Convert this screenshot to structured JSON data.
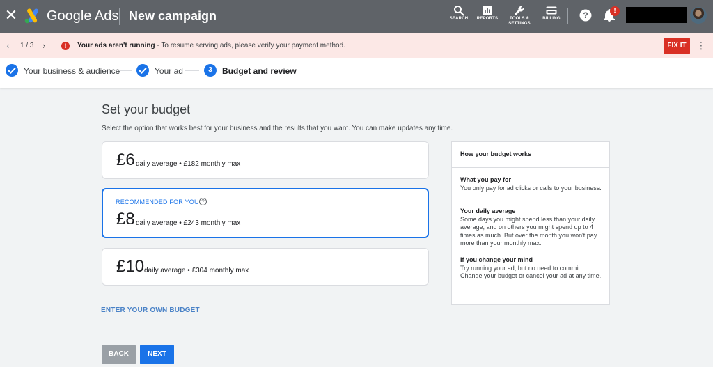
{
  "header": {
    "close_icon": "close-icon",
    "product_name": "Google Ads",
    "campaign_title": "New campaign",
    "tools": [
      {
        "label": "SEARCH",
        "icon": "search-icon"
      },
      {
        "label": "REPORTS",
        "icon": "reports-icon"
      },
      {
        "label": "TOOLS & SETTINGS",
        "icon": "wrench-icon"
      },
      {
        "label": "BILLING",
        "icon": "billing-card-icon"
      }
    ],
    "notification_count": "!",
    "colors": {
      "bar": "#5f6368",
      "accent": "#1a73e8"
    }
  },
  "alert": {
    "page_indicator": "1 / 3",
    "alert_icon_glyph": "!",
    "title": "Your ads aren't running",
    "message": " - To resume serving ads, please verify your payment method.",
    "fix_label": "FIX IT",
    "colors": {
      "background": "#fce8e6",
      "error": "#d93025"
    }
  },
  "stepper": {
    "steps": [
      {
        "label": "Your business & audience",
        "state": "done"
      },
      {
        "label": "Your ad",
        "state": "done"
      },
      {
        "label": "Budget and review",
        "state": "current",
        "number": "3"
      }
    ]
  },
  "main": {
    "title": "Set your budget",
    "subtitle": "Select the option that works best for your business and the results that you want. You can make updates any time.",
    "options": [
      {
        "amount": "£6",
        "description": "daily average • £182 monthly max",
        "selected": false
      },
      {
        "badge": "RECOMMENDED FOR YOU",
        "help_glyph": "?",
        "amount": "£8",
        "description": "daily average • £243 monthly max",
        "selected": true
      },
      {
        "amount": "£10",
        "description": "daily average • £304 monthly max",
        "selected": false
      }
    ],
    "own_budget_link": "ENTER YOUR OWN BUDGET",
    "back_label": "BACK",
    "next_label": "NEXT"
  },
  "info_panel": {
    "title": "How your budget works",
    "sections": [
      {
        "heading": "What you pay for",
        "body": "You only pay for ad clicks or calls to your business."
      },
      {
        "heading": "Your daily average",
        "body": "Some days you might spend less than your daily average, and on others you might spend up to 4 times as much. But over the month you won't pay more than your monthly max."
      },
      {
        "heading": "If you change your mind",
        "body": "Try running your ad, but no need to commit. Change your budget or cancel your ad at any time."
      }
    ]
  }
}
